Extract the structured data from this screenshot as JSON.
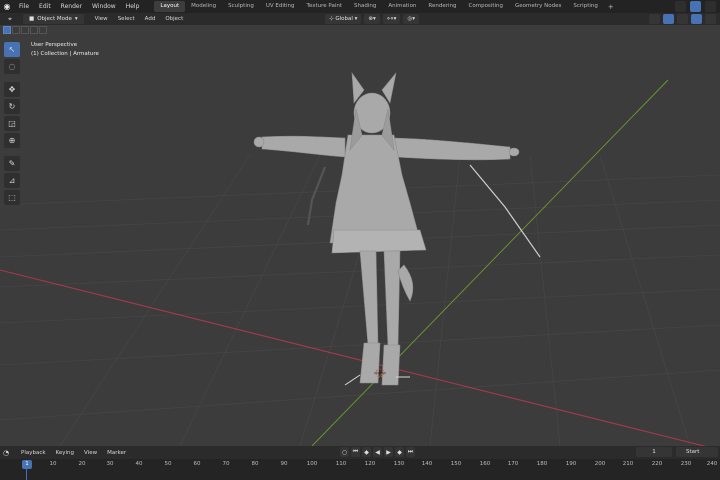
{
  "app": {
    "menu": [
      "File",
      "Edit",
      "Render",
      "Window",
      "Help"
    ],
    "workspace_tabs": [
      {
        "label": "Layout",
        "active": true
      },
      {
        "label": "Modeling",
        "active": false
      },
      {
        "label": "Sculpting",
        "active": false
      },
      {
        "label": "UV Editing",
        "active": false
      },
      {
        "label": "Texture Paint",
        "active": false
      },
      {
        "label": "Shading",
        "active": false
      },
      {
        "label": "Animation",
        "active": false
      },
      {
        "label": "Rendering",
        "active": false
      },
      {
        "label": "Compositing",
        "active": false
      },
      {
        "label": "Geometry Nodes",
        "active": false
      },
      {
        "label": "Scripting",
        "active": false
      }
    ],
    "add_tab": "+"
  },
  "header": {
    "mode": "Object Mode",
    "menu": [
      "View",
      "Select",
      "Add",
      "Object"
    ],
    "orientation": "Global"
  },
  "viewport": {
    "perspective": "User Perspective",
    "collection": "(1) Collection | Armature"
  },
  "timeline": {
    "menu": [
      "Playback",
      "Keying",
      "View",
      "Marker"
    ],
    "current_frame": "1",
    "start_label": "Start",
    "ruler_current": "1",
    "ticks": [
      "10",
      "20",
      "30",
      "40",
      "50",
      "60",
      "70",
      "80",
      "90",
      "100",
      "110",
      "120",
      "130",
      "140",
      "150",
      "160",
      "170",
      "180",
      "190",
      "200",
      "210",
      "220",
      "230",
      "240"
    ]
  },
  "colors": {
    "accent": "#4772b3",
    "viewport_bg": "#3c3c3c",
    "x_axis": "#b5394d",
    "y_axis": "#6b9a2e"
  }
}
